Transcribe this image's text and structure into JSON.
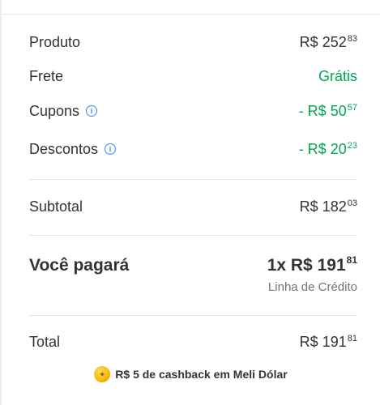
{
  "summary": {
    "product": {
      "label": "Produto",
      "currency": "R$",
      "whole": "252",
      "cents": "83"
    },
    "shipping": {
      "label": "Frete",
      "value": "Grátis"
    },
    "coupons": {
      "label": "Cupons",
      "prefix": "- R$",
      "whole": "50",
      "cents": "57"
    },
    "discounts": {
      "label": "Descontos",
      "prefix": "- R$",
      "whole": "20",
      "cents": "23"
    },
    "subtotal": {
      "label": "Subtotal",
      "currency": "R$",
      "whole": "182",
      "cents": "03"
    },
    "pay": {
      "label": "Você pagará",
      "prefix": "1x R$",
      "whole": "191",
      "cents": "81",
      "method": "Linha de Crédito"
    },
    "total": {
      "label": "Total",
      "currency": "R$",
      "whole": "191",
      "cents": "81"
    },
    "cashback": {
      "text": "R$ 5 de cashback em Meli Dólar"
    }
  },
  "colors": {
    "green": "#00a650",
    "info_blue": "#3483fa",
    "coin": "#f5b700"
  },
  "icons": [
    "info-icon",
    "coin-icon"
  ]
}
